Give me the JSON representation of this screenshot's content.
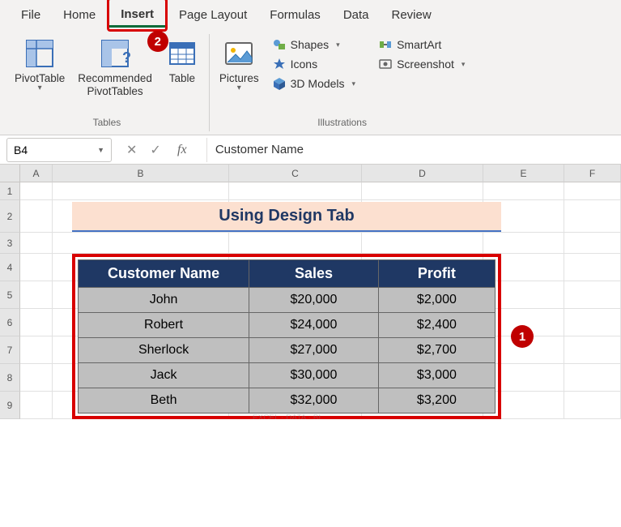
{
  "tabs": {
    "file": "File",
    "home": "Home",
    "insert": "Insert",
    "page_layout": "Page Layout",
    "formulas": "Formulas",
    "data": "Data",
    "review": "Review",
    "active": "insert"
  },
  "ribbon": {
    "tables_group_label": "Tables",
    "pivot_table": "PivotTable",
    "recommended_pivot": "Recommended\nPivotTables",
    "table": "Table",
    "illustrations_group_label": "Illustrations",
    "pictures": "Pictures",
    "shapes": "Shapes",
    "icons": "Icons",
    "models": "3D Models",
    "smartart": "SmartArt",
    "screenshot": "Screenshot"
  },
  "namebox": "B4",
  "formula": "Customer Name",
  "columns": {
    "A": 40,
    "B": 218,
    "C": 164,
    "D": 150,
    "E": 100,
    "F": 70
  },
  "row_heights": {
    "1": 22,
    "2": 40,
    "3": 26,
    "r": 34
  },
  "title_banner": "Using Design Tab",
  "table": {
    "headers": [
      "Customer Name",
      "Sales",
      "Profit"
    ],
    "rows": [
      [
        "John",
        "$20,000",
        "$2,000"
      ],
      [
        "Robert",
        "$24,000",
        "$2,400"
      ],
      [
        "Sherlock",
        "$27,000",
        "$2,700"
      ],
      [
        "Jack",
        "$30,000",
        "$3,000"
      ],
      [
        "Beth",
        "$32,000",
        "$3,200"
      ]
    ]
  },
  "callouts": {
    "one": "1",
    "two": "2"
  },
  "chart_data": {
    "type": "table",
    "title": "Using Design Tab",
    "columns": [
      "Customer Name",
      "Sales",
      "Profit"
    ],
    "rows": [
      {
        "Customer Name": "John",
        "Sales": 20000,
        "Profit": 2000
      },
      {
        "Customer Name": "Robert",
        "Sales": 24000,
        "Profit": 2400
      },
      {
        "Customer Name": "Sherlock",
        "Sales": 27000,
        "Profit": 2700
      },
      {
        "Customer Name": "Jack",
        "Sales": 30000,
        "Profit": 3000
      },
      {
        "Customer Name": "Beth",
        "Sales": 32000,
        "Profit": 3200
      }
    ]
  }
}
